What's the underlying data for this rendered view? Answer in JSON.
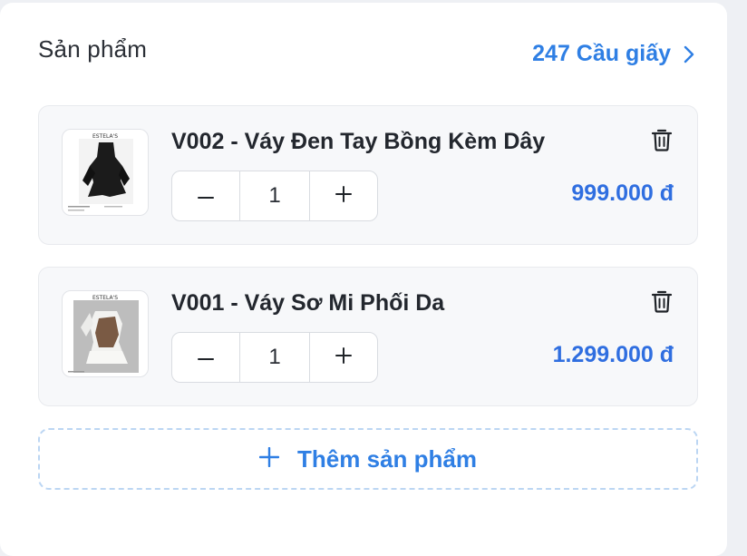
{
  "section": {
    "title": "Sản phẩm",
    "store_link_label": "247 Cầu giấy"
  },
  "products": [
    {
      "name": "V002 - Váy Đen Tay Bồng Kèm Dây",
      "quantity": "1",
      "price": "999.000 đ",
      "thumb_brand": "ESTELA'S"
    },
    {
      "name": "V001 - Váy Sơ Mi Phối Da",
      "quantity": "1",
      "price": "1.299.000 đ",
      "thumb_brand": "ESTELA'S"
    }
  ],
  "add_product_label": "Thêm sản phẩm",
  "icons": {
    "store_link": "chevron-right-icon",
    "delete": "trash-icon",
    "decrease": "minus-icon",
    "increase": "plus-icon",
    "add": "plus-icon"
  },
  "colors": {
    "accent": "#2f7fe4",
    "price": "#2f6ee0",
    "title": "#2b2f36",
    "product_name": "#23272e",
    "card_bg": "#ffffff",
    "item_bg": "#f7f8fa",
    "page_bg": "#eef0f4"
  }
}
